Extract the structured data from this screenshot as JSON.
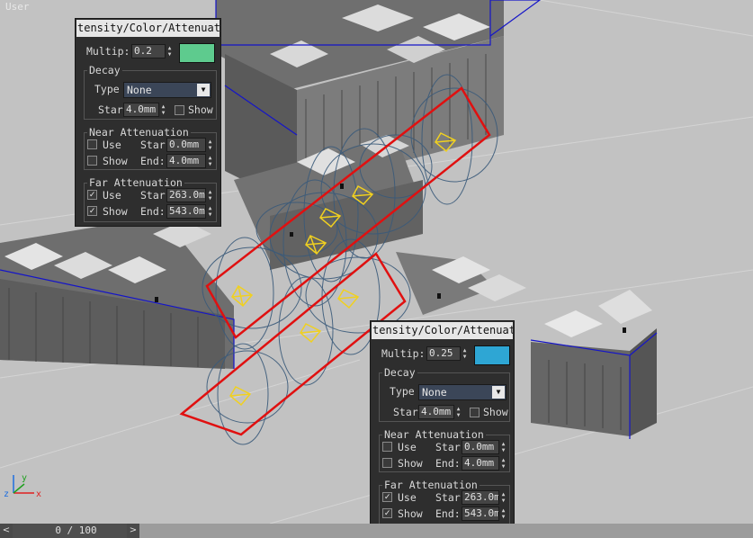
{
  "viewport": {
    "label": "User"
  },
  "panels": [
    {
      "title": "tensity/Color/Attenuati",
      "multiplier": {
        "label": "Multip:",
        "value": "0.2"
      },
      "color": "#5ecb8e",
      "decay": {
        "title": "Decay",
        "type_label": "Type",
        "type_value": "None",
        "start_label": "Star",
        "start_value": "4.0mm",
        "show_label": "Show"
      },
      "near": {
        "title": "Near Attenuation",
        "use_label": "Use",
        "show_label": "Show",
        "start_label": "Star",
        "start_value": "0.0mm",
        "end_label": "End:",
        "end_value": "4.0mm",
        "use_checked": false,
        "show_checked": false
      },
      "far": {
        "title": "Far Attenuation",
        "use_label": "Use",
        "show_label": "Show",
        "start_label": "Star",
        "start_value": "263.0m",
        "end_label": "End:",
        "end_value": "543.0m",
        "use_checked": true,
        "show_checked": true
      }
    },
    {
      "title": "tensity/Color/Attenuati",
      "multiplier": {
        "label": "Multip:",
        "value": "0.25"
      },
      "color": "#2ea6d4",
      "decay": {
        "title": "Decay",
        "type_label": "Type",
        "type_value": "None",
        "start_label": "Star",
        "start_value": "4.0mm",
        "show_label": "Show"
      },
      "near": {
        "title": "Near Attenuation",
        "use_label": "Use",
        "show_label": "Show",
        "start_label": "Star",
        "start_value": "0.0mm",
        "end_label": "End:",
        "end_value": "4.0mm",
        "use_checked": false,
        "show_checked": false
      },
      "far": {
        "title": "Far Attenuation",
        "use_label": "Use",
        "show_label": "Show",
        "start_label": "Star",
        "start_value": "263.0m",
        "end_label": "End:",
        "end_value": "543.0m",
        "use_checked": true,
        "show_checked": true
      }
    }
  ],
  "timeline": {
    "position": "0 / 100",
    "prev_icon": "<",
    "next_icon": ">"
  },
  "axis": {
    "x": "x",
    "y": "y",
    "z": "z"
  },
  "colors": {
    "selection": "#e01010",
    "light_glyph": "#f0d020",
    "bbox": "#1515c8",
    "falloff": "#3a5a7a"
  }
}
